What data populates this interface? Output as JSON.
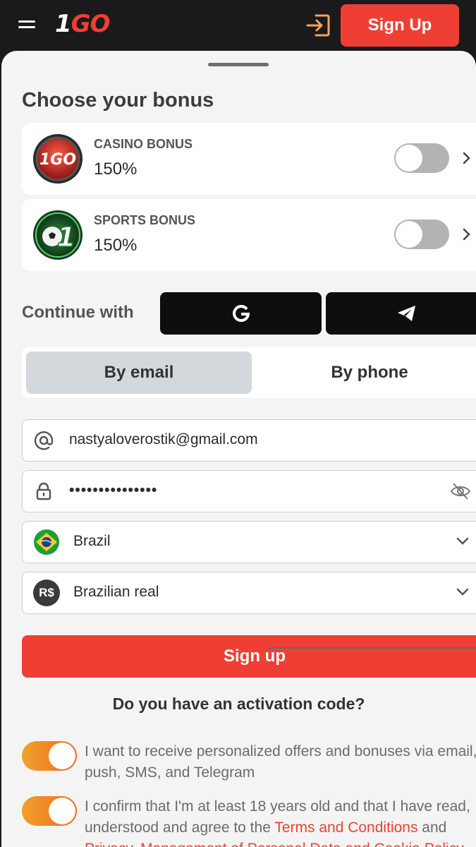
{
  "header": {
    "logo_one": "1",
    "logo_go": "GO",
    "signup_label": "Sign Up",
    "menu_icon": "hamburger-icon",
    "login_icon": "login-icon"
  },
  "bonus": {
    "title": "Choose your bonus",
    "items": [
      {
        "name": "CASINO BONUS",
        "value": "150%",
        "enabled": false,
        "emblem_text": "1GO"
      },
      {
        "name": "SPORTS BONUS",
        "value": "150%",
        "enabled": false,
        "emblem_text": "1"
      }
    ]
  },
  "social": {
    "label": "Continue with",
    "providers": [
      "google-icon",
      "telegram-icon"
    ]
  },
  "tabs": {
    "email": "By email",
    "phone": "By phone",
    "active": "email"
  },
  "form": {
    "email": "nastyaloverostik@gmail.com",
    "password": "•••••••••••••••",
    "country": "Brazil",
    "currency": "Brazilian real",
    "currency_symbol": "R$",
    "submit": "Sign up"
  },
  "activation": "Do you have an activation code?",
  "consents": {
    "offers": "I want to receive personalized offers and bonuses via email, push, SMS, and Telegram",
    "age_prefix": "I confirm that I'm at least 18 years old and that I have read, understood and agree to the ",
    "terms_link": "Terms and Conditions",
    "age_and": " and ",
    "privacy_link": "Privacy, Management of Personal Data and Cookie Policy",
    "offers_enabled": true,
    "age_enabled": true
  },
  "colors": {
    "accent": "#ef3f34",
    "toggle_on": "#f1a22a",
    "header_bg": "#1a1a1a"
  }
}
